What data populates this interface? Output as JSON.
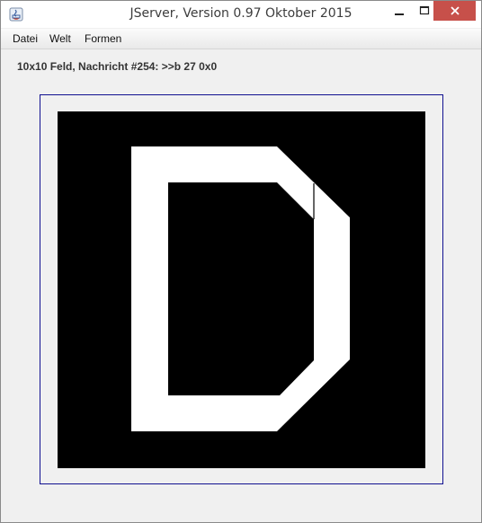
{
  "window": {
    "title": "JServer, Version 0.97 Oktober 2015"
  },
  "menu": {
    "items": [
      "Datei",
      "Welt",
      "Formen"
    ]
  },
  "status": {
    "text": "10x10 Feld, Nachricht #254: >>b 27 0x0"
  },
  "board": {
    "background_color": "#000000",
    "shape_color": "#ffffff",
    "shape": "letter-D"
  }
}
